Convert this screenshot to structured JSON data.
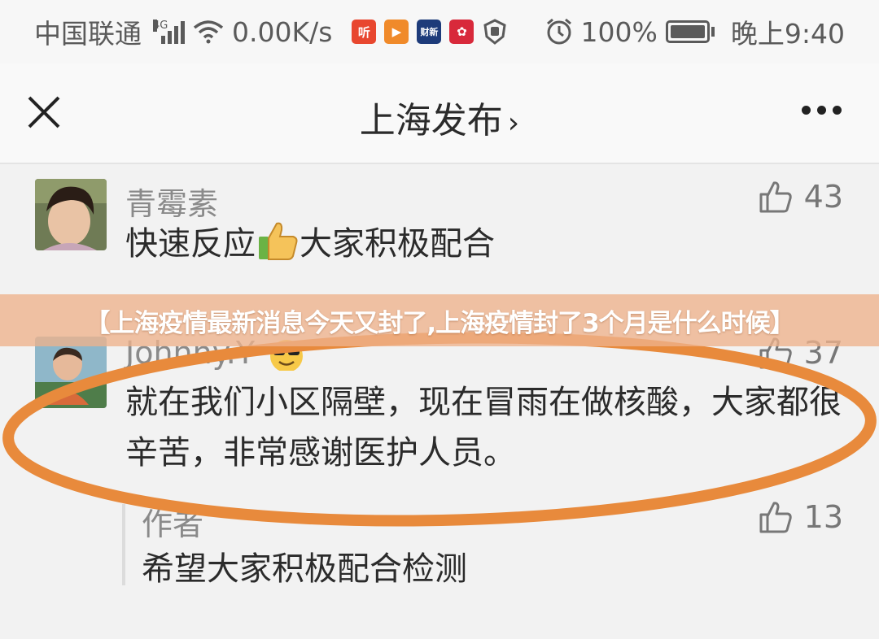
{
  "status_bar": {
    "carrier": "中国联通",
    "network_type": "4G",
    "speed": "0.00K/s",
    "battery": "100%",
    "time": "晚上9:40",
    "apps": [
      {
        "name": "听",
        "color": "#e8472f"
      },
      {
        "name": "▶",
        "color": "#f08a2a"
      },
      {
        "name": "财新",
        "color": "#1d3b7a"
      },
      {
        "name": "✿",
        "color": "#d8293b"
      }
    ]
  },
  "header": {
    "title": "上海发布",
    "chevron": "›"
  },
  "comments": [
    {
      "user": "青霉素",
      "text_before": "快速反应",
      "text_after": "大家积极配合",
      "likes": "43"
    },
    {
      "user": "Johnny.Y",
      "text": "就在我们小区隔壁，现在冒雨在做核酸，大家都很辛苦，非常感谢医护人员。",
      "likes": "37"
    }
  ],
  "reply": {
    "user": "作者",
    "text": "希望大家积极配合检测",
    "likes": "13"
  },
  "banner": {
    "text": "【上海疫情最新消息今天又封了,上海疫情封了3个月是什么时候】"
  },
  "colors": {
    "highlight_ellipse": "#e88a3c",
    "banner": "#eeb28c"
  }
}
